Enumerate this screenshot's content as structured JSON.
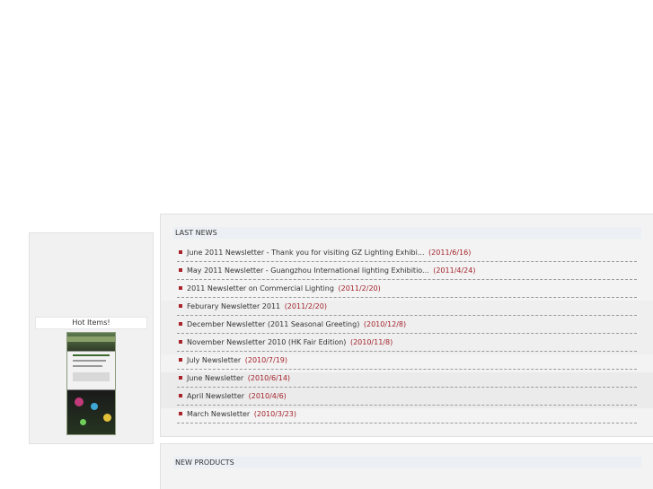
{
  "sidebar": {
    "hot_items_title": "Hot Items!",
    "thumbnail_name": "hot-item-thumbnail"
  },
  "last_news": {
    "title": "LAST NEWS",
    "items": [
      {
        "title": "June 2011 Newsletter - Thank you for visiting GZ Lighting Exhibi...",
        "date": "(2011/6/16)"
      },
      {
        "title": "May 2011 Newsletter - Guangzhou International lighting Exhibitio...",
        "date": "(2011/4/24)"
      },
      {
        "title": "2011 Newsletter on Commercial Lighting",
        "date": "(2011/2/20)"
      },
      {
        "title": "Feburary Newsletter 2011",
        "date": "(2011/2/20)"
      },
      {
        "title": "December Newsletter (2011 Seasonal Greeting)",
        "date": "(2010/12/8)"
      },
      {
        "title": "November Newsletter 2010 (HK Fair Edition)",
        "date": "(2010/11/8)"
      },
      {
        "title": "July Newsletter",
        "date": "(2010/7/19)"
      },
      {
        "title": "June Newsletter",
        "date": "(2010/6/14)"
      },
      {
        "title": "April Newsletter",
        "date": "(2010/4/6)"
      },
      {
        "title": "March Newsletter",
        "date": "(2010/3/23)"
      }
    ]
  },
  "new_products": {
    "title": "NEW PRODUCTS"
  },
  "colors": {
    "accent_red": "#a3222a",
    "panel_bg": "#f3f3f3",
    "header_bg": "#ecf0f5"
  }
}
